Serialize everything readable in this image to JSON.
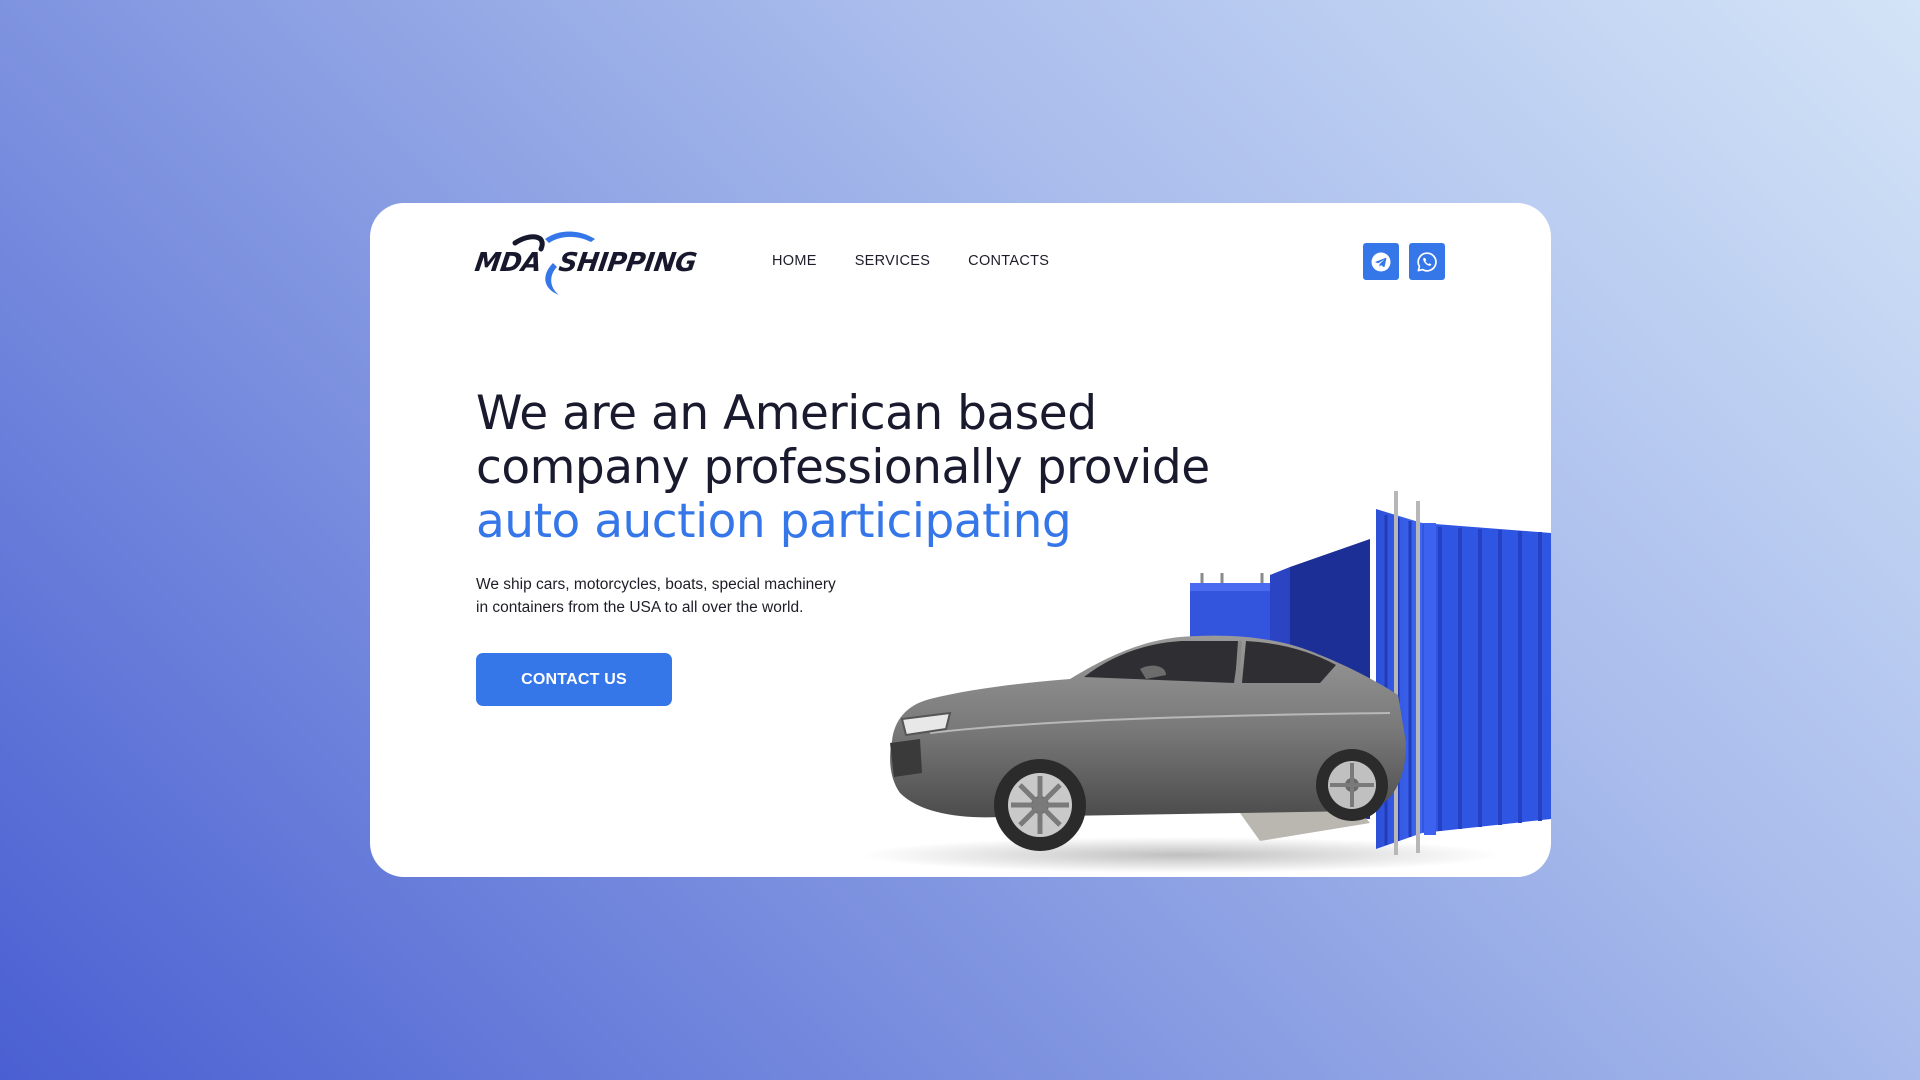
{
  "brand": {
    "logo_left": "MDA",
    "logo_right": "SHIPPING",
    "accent_color": "#3577e9",
    "dark_color": "#17182e"
  },
  "nav": {
    "items": [
      {
        "label": "HOME"
      },
      {
        "label": "SERVICES"
      },
      {
        "label": "CONTACTS"
      }
    ]
  },
  "social": {
    "items": [
      {
        "icon": "telegram-icon"
      },
      {
        "icon": "whatsapp-icon"
      }
    ]
  },
  "hero": {
    "headline_line1": "We are an American based",
    "headline_line2": "company professionally provide",
    "headline_accent": "auto auction participating",
    "subtext_line1": "We ship cars, motorcycles, boats, special machinery",
    "subtext_line2": "in containers from the USA to all over the world.",
    "cta_label": "CONTACT US",
    "image": "car-container-illustration"
  }
}
